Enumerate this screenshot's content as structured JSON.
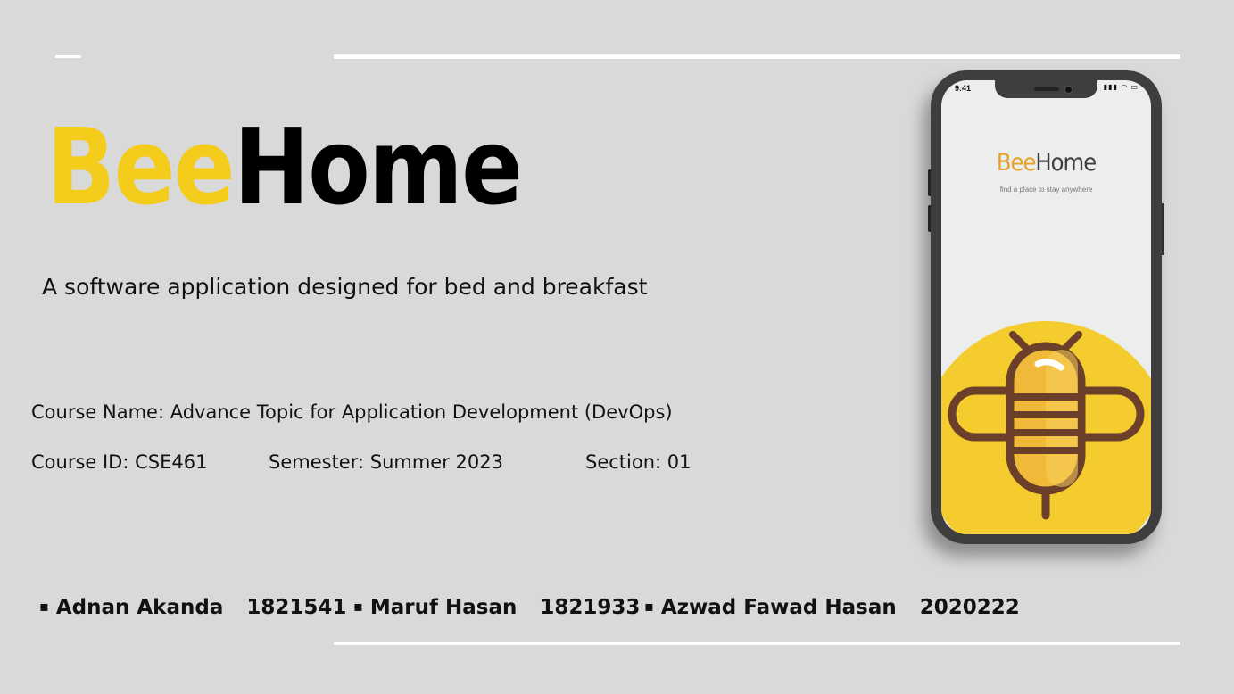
{
  "slide": {
    "logo": {
      "part1": "Bee",
      "part2": "Home"
    },
    "tagline": "A software application designed for bed and breakfast",
    "course_name": "Course Name: Advance Topic for Application Development  (DevOps)",
    "course_id": "Course ID: CSE461",
    "semester": "Semester: Summer 2023",
    "section": "Section: 01",
    "members": [
      {
        "name": "Adnan Akanda",
        "id": "1821541"
      },
      {
        "name": "Maruf Hasan",
        "id": "1821933"
      },
      {
        "name": "Azwad Fawad Hasan",
        "id": "2020222"
      }
    ],
    "bullet": "▪"
  },
  "phone": {
    "time": "9:41",
    "app_logo": {
      "part1": "Bee",
      "part2": "Home"
    },
    "app_subtitle": "find a place to stay anywhere",
    "icons": [
      "signal-icon",
      "wifi-icon",
      "battery-icon"
    ]
  },
  "colors": {
    "background": "#d9d9d9",
    "logo_yellow": "#f4cc1c",
    "app_orange": "#e6a12a",
    "bee_yellow": "#f4cc2e",
    "bee_brown": "#6b3f2a",
    "phone_frame": "#3e3e3e"
  }
}
